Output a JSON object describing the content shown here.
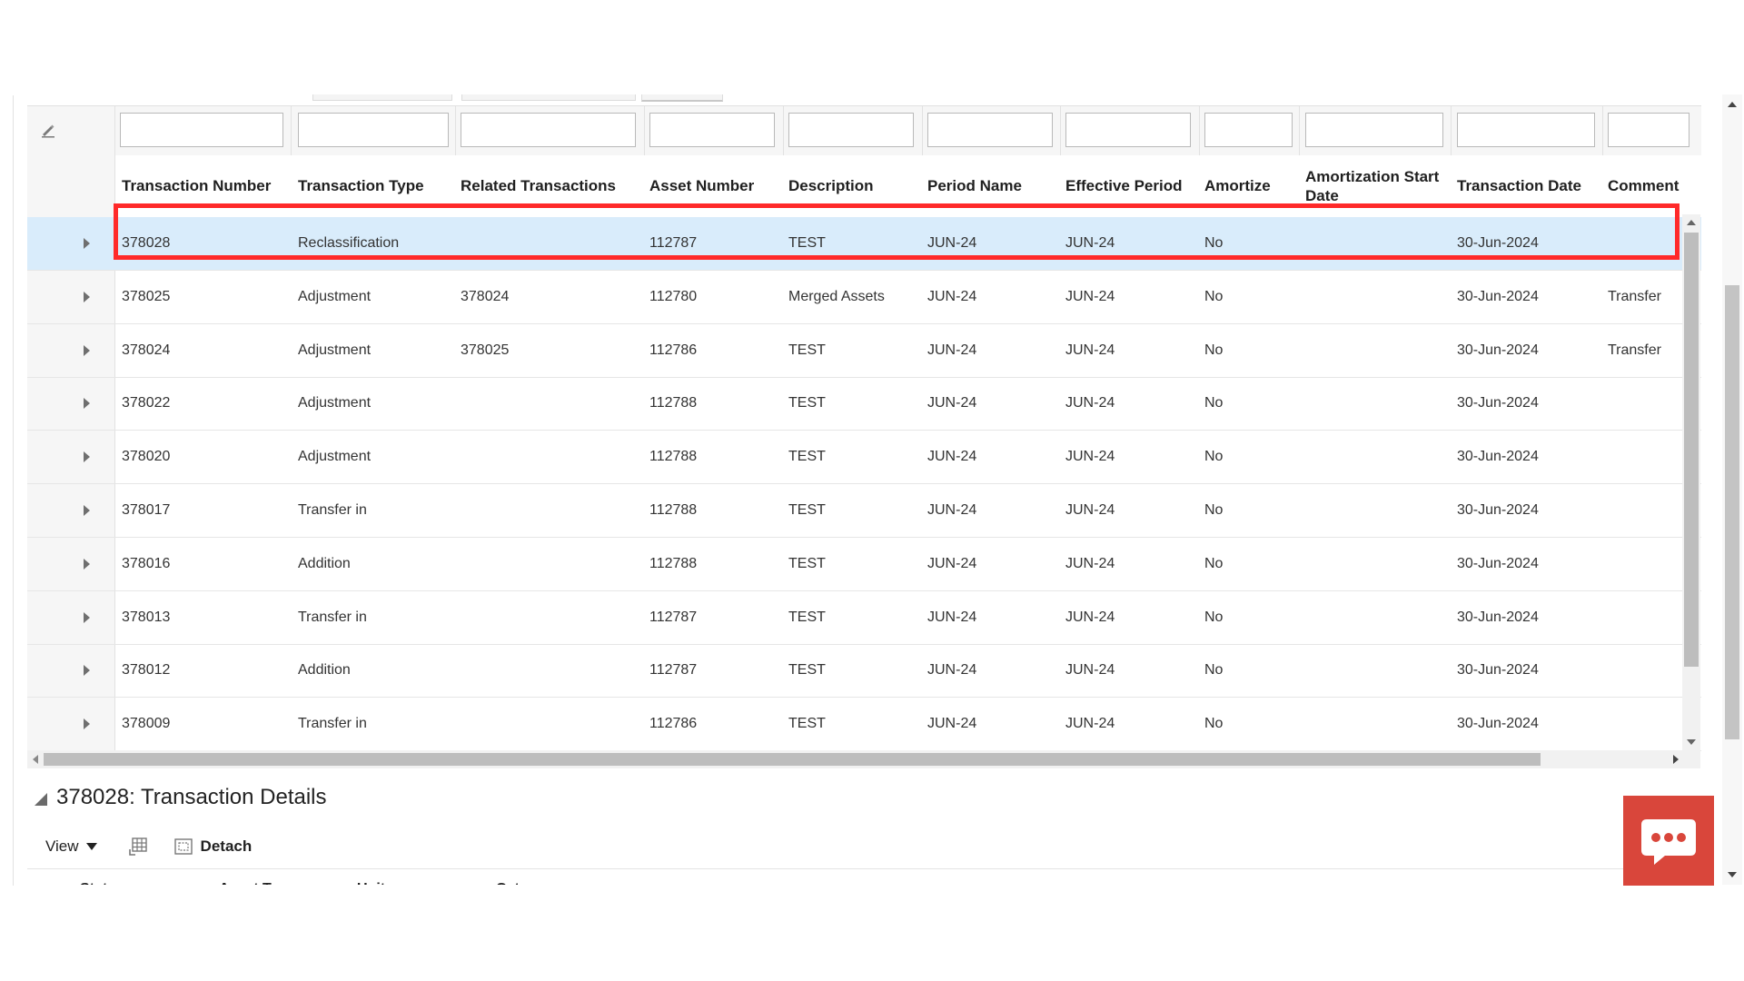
{
  "table": {
    "headers": [
      {
        "id": "transaction-number",
        "label": "Transaction Number"
      },
      {
        "id": "transaction-type",
        "label": "Transaction Type"
      },
      {
        "id": "related-transactions",
        "label": "Related Transactions"
      },
      {
        "id": "asset-number",
        "label": "Asset Number"
      },
      {
        "id": "description",
        "label": "Description"
      },
      {
        "id": "period-name",
        "label": "Period Name"
      },
      {
        "id": "effective-period",
        "label": "Effective Period"
      },
      {
        "id": "amortize",
        "label": "Amortize"
      },
      {
        "id": "amortization-start-date",
        "label": "Amortization Start Date"
      },
      {
        "id": "transaction-date",
        "label": "Transaction Date"
      },
      {
        "id": "comments",
        "label": "Comment"
      }
    ],
    "rows": [
      [
        "378028",
        "Reclassification",
        "",
        "112787",
        "TEST",
        "JUN-24",
        "JUN-24",
        "No",
        "",
        "30-Jun-2024",
        ""
      ],
      [
        "378025",
        "Adjustment",
        "378024",
        "112780",
        "Merged Assets",
        "JUN-24",
        "JUN-24",
        "No",
        "",
        "30-Jun-2024",
        "Transfer"
      ],
      [
        "378024",
        "Adjustment",
        "378025",
        "112786",
        "TEST",
        "JUN-24",
        "JUN-24",
        "No",
        "",
        "30-Jun-2024",
        "Transfer"
      ],
      [
        "378022",
        "Adjustment",
        "",
        "112788",
        "TEST",
        "JUN-24",
        "JUN-24",
        "No",
        "",
        "30-Jun-2024",
        ""
      ],
      [
        "378020",
        "Adjustment",
        "",
        "112788",
        "TEST",
        "JUN-24",
        "JUN-24",
        "No",
        "",
        "30-Jun-2024",
        ""
      ],
      [
        "378017",
        "Transfer in",
        "",
        "112788",
        "TEST",
        "JUN-24",
        "JUN-24",
        "No",
        "",
        "30-Jun-2024",
        ""
      ],
      [
        "378016",
        "Addition",
        "",
        "112788",
        "TEST",
        "JUN-24",
        "JUN-24",
        "No",
        "",
        "30-Jun-2024",
        ""
      ],
      [
        "378013",
        "Transfer in",
        "",
        "112787",
        "TEST",
        "JUN-24",
        "JUN-24",
        "No",
        "",
        "30-Jun-2024",
        ""
      ],
      [
        "378012",
        "Addition",
        "",
        "112787",
        "TEST",
        "JUN-24",
        "JUN-24",
        "No",
        "",
        "30-Jun-2024",
        ""
      ],
      [
        "378009",
        "Transfer in",
        "",
        "112786",
        "TEST",
        "JUN-24",
        "JUN-24",
        "No",
        "",
        "30-Jun-2024",
        ""
      ]
    ],
    "selected_row": 0
  },
  "details": {
    "title": "378028: Transaction Details",
    "view_label": "View",
    "detach_label": "Detach",
    "sub_headers": [
      "Status",
      "Asset Type",
      "Units",
      "Category"
    ]
  },
  "icons": {
    "filter_clear": "pencil-eraser-icon",
    "freeze": "freeze-columns-icon",
    "detach": "detach-window-icon",
    "chat": "chat-bubble-icon"
  },
  "colors": {
    "highlight": "#ff2a2a",
    "selected_row": "#d9ecfb",
    "chat_button": "#d9463b"
  }
}
